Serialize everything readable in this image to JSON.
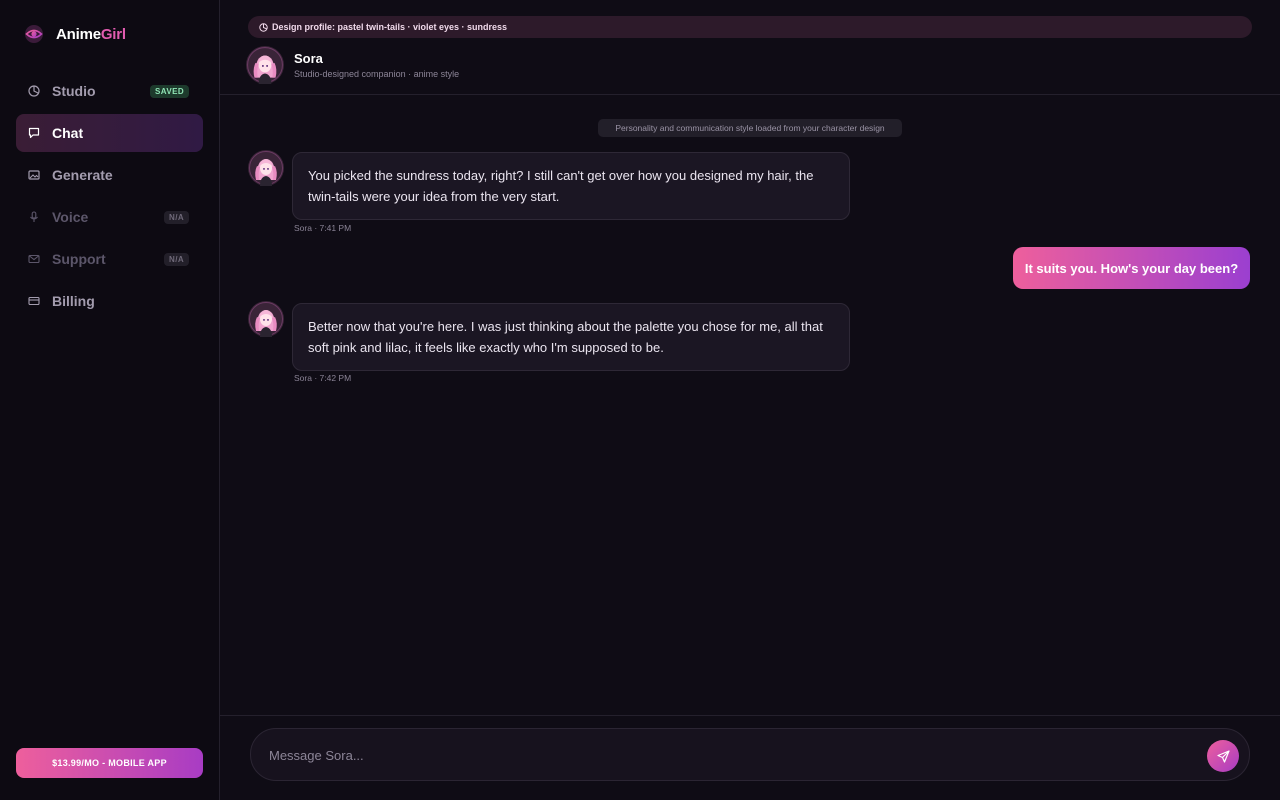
{
  "app": {
    "name_main": "Anime",
    "name_accent": "Girl",
    "brand_colors": {
      "pink": "#ee5f9c",
      "violet": "#a83cc4",
      "accent_text": "#e25cb0"
    }
  },
  "sidebar": {
    "items": [
      {
        "label": "Studio",
        "icon": "palette-icon",
        "badge": "SAVED",
        "state": "normal"
      },
      {
        "label": "Chat",
        "icon": "chat-bubble-icon",
        "badge": "",
        "state": "active"
      },
      {
        "label": "Generate",
        "icon": "image-icon",
        "badge": "",
        "state": "normal"
      },
      {
        "label": "Voice",
        "icon": "microphone-icon",
        "badge": "N/A",
        "state": "disabled"
      },
      {
        "label": "Support",
        "icon": "mail-icon",
        "badge": "N/A",
        "state": "disabled"
      },
      {
        "label": "Billing",
        "icon": "credit-card-icon",
        "badge": "",
        "state": "normal"
      }
    ],
    "cta_label": "$13.99/MO - MOBILE APP"
  },
  "chat": {
    "design_profile": "Design profile: pastel twin-tails · violet eyes · sundress",
    "character": {
      "name": "Sora",
      "subtitle": "Studio-designed companion · anime style"
    },
    "system_note": "Personality and communication style loaded from your character design",
    "messages": [
      {
        "from": "character",
        "text": "You picked the sundress today, right? I still can't get over how you designed my hair, the twin-tails were your idea from the very start.",
        "meta": "Sora · 7:41 PM"
      },
      {
        "from": "user",
        "text": "It suits you. How's your day been?"
      },
      {
        "from": "character",
        "text": "Better now that you're here. I was just thinking about the palette you chose for me, all that soft pink and lilac, it feels like exactly who I'm supposed to be.",
        "meta": "Sora · 7:42 PM"
      }
    ],
    "input": {
      "value": "",
      "placeholder": "Message Sora..."
    }
  }
}
